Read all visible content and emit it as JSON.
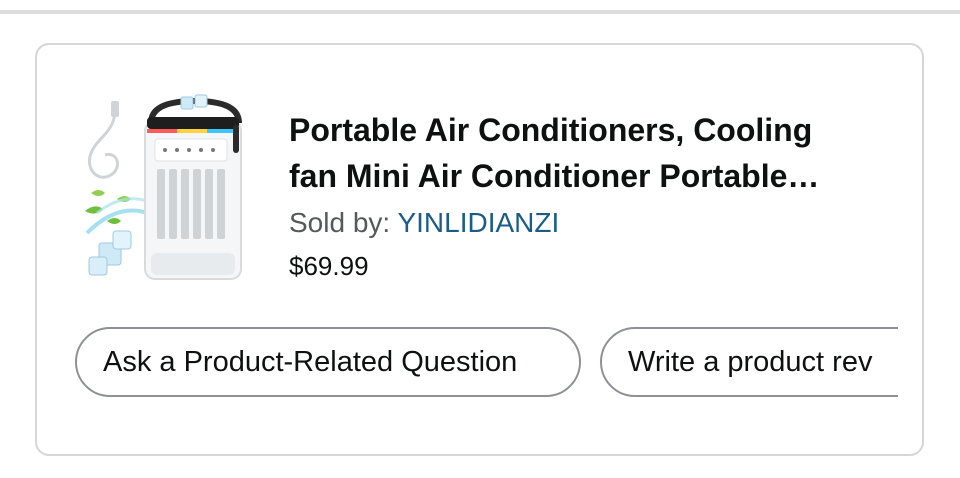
{
  "product": {
    "title_line1": "Portable Air Conditioners, Cooling",
    "title_line2": "fan Mini Air Conditioner Portable…",
    "sold_by_label": "Sold by: ",
    "seller_name": "YINLIDIANZI",
    "price": "$69.99",
    "image_icon": "portable-air-conditioner-image"
  },
  "actions": {
    "ask_question_label": "Ask a Product-Related Question",
    "write_review_label": "Write a product rev"
  },
  "colors": {
    "seller_link": "#1a5c8c",
    "text": "#0f1111",
    "muted": "#565959",
    "border": "#d6d6d6"
  }
}
